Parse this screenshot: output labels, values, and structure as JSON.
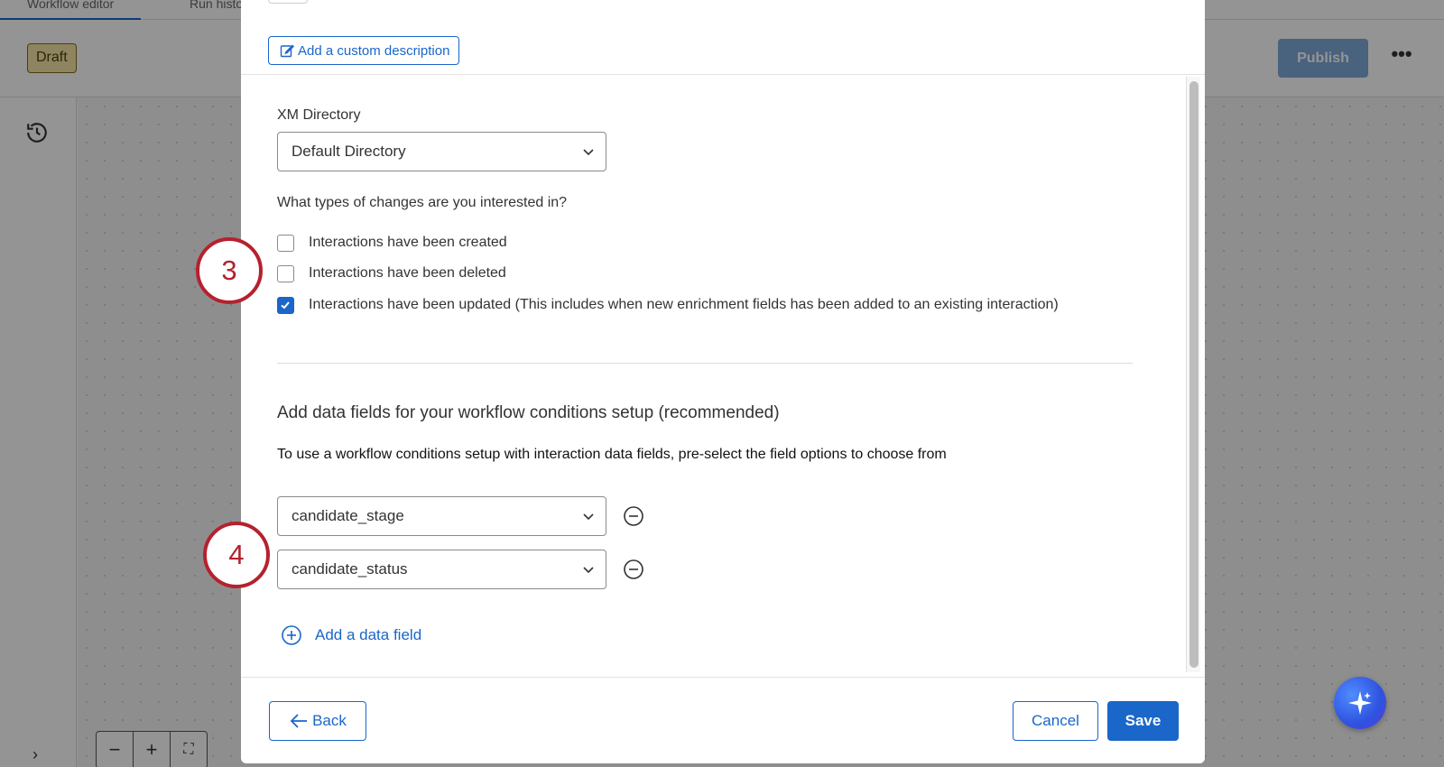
{
  "background": {
    "tabs": [
      {
        "label": "Workflow editor"
      },
      {
        "label": "Run history"
      }
    ],
    "draft_badge": "Draft",
    "publish_label": "Publish",
    "more_label": "•••"
  },
  "modal": {
    "custom_description_label": "Add a custom description",
    "directory": {
      "label": "XM Directory",
      "selected": "Default Directory"
    },
    "changes_question": "What types of changes are you interested in?",
    "change_options": [
      {
        "label": "Interactions have been created",
        "checked": false
      },
      {
        "label": "Interactions have been deleted",
        "checked": false
      },
      {
        "label": "Interactions have been updated (This includes when new enrichment fields has been added to an existing interaction)",
        "checked": true
      }
    ],
    "data_fields_section": {
      "title": "Add data fields for your workflow conditions setup (recommended)",
      "description": "To use a workflow conditions setup with interaction data fields, pre-select the field options to choose from",
      "fields": [
        {
          "value": "candidate_stage"
        },
        {
          "value": "candidate_status"
        }
      ],
      "add_label": "Add a data field"
    },
    "footer": {
      "back_label": "Back",
      "cancel_label": "Cancel",
      "save_label": "Save"
    }
  },
  "markers": [
    {
      "number": "3"
    },
    {
      "number": "4"
    }
  ],
  "colors": {
    "accent": "#1a66c9",
    "marker": "#b5212e",
    "draft_badge_bg": "#f4e6a6"
  }
}
